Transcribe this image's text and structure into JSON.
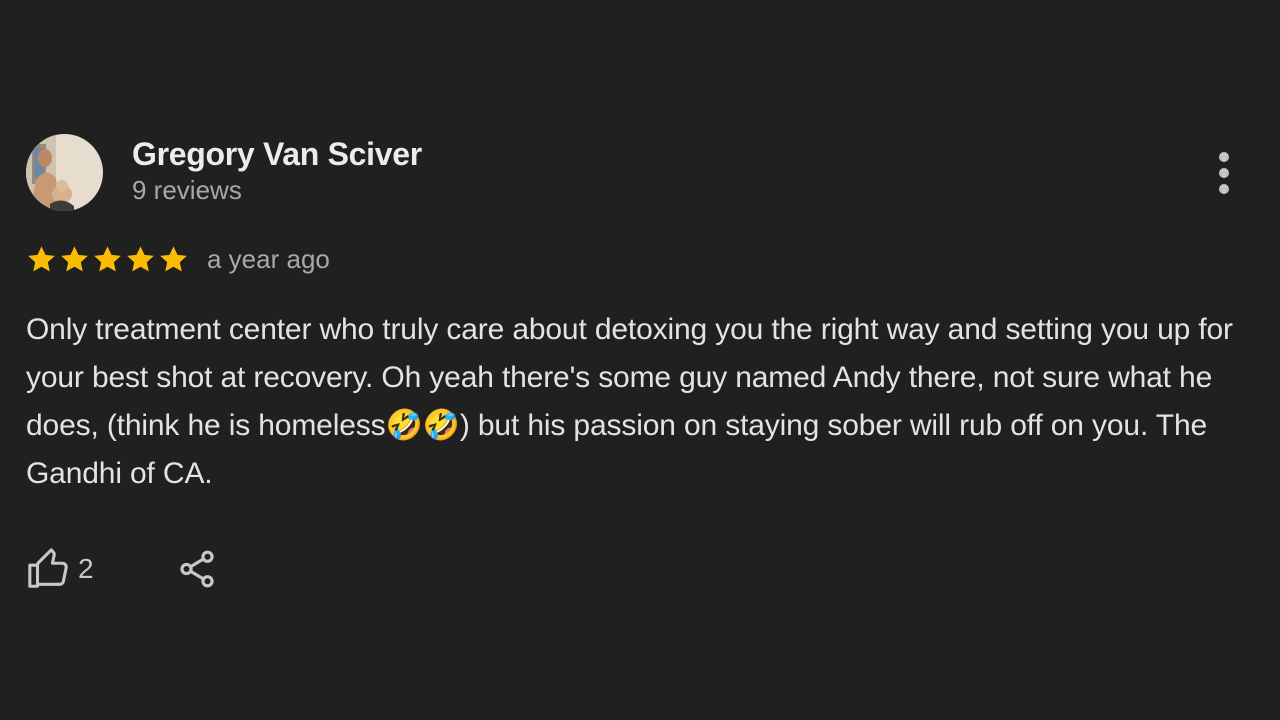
{
  "review": {
    "author_name": "Gregory Van Sciver",
    "author_meta": "9 reviews",
    "rating": 5,
    "rating_max": 5,
    "time": "a year ago",
    "text": "Only treatment center who truly care about detoxing you the right way and setting you up for your best shot at recovery. Oh yeah there's some guy named Andy there, not sure what he does, (think he is homeless🤣🤣) but his passion on staying sober will rub off on you. The Gandhi of CA.",
    "likes": "2"
  },
  "icons": {
    "avatar": "avatar",
    "more": "more-vert-icon",
    "star": "star-icon",
    "like": "thumb-up-icon",
    "share": "share-icon"
  },
  "colors": {
    "background": "#202020",
    "star": "#fbbc04",
    "text": "#e3e3e3",
    "muted": "#a8a8a8"
  }
}
